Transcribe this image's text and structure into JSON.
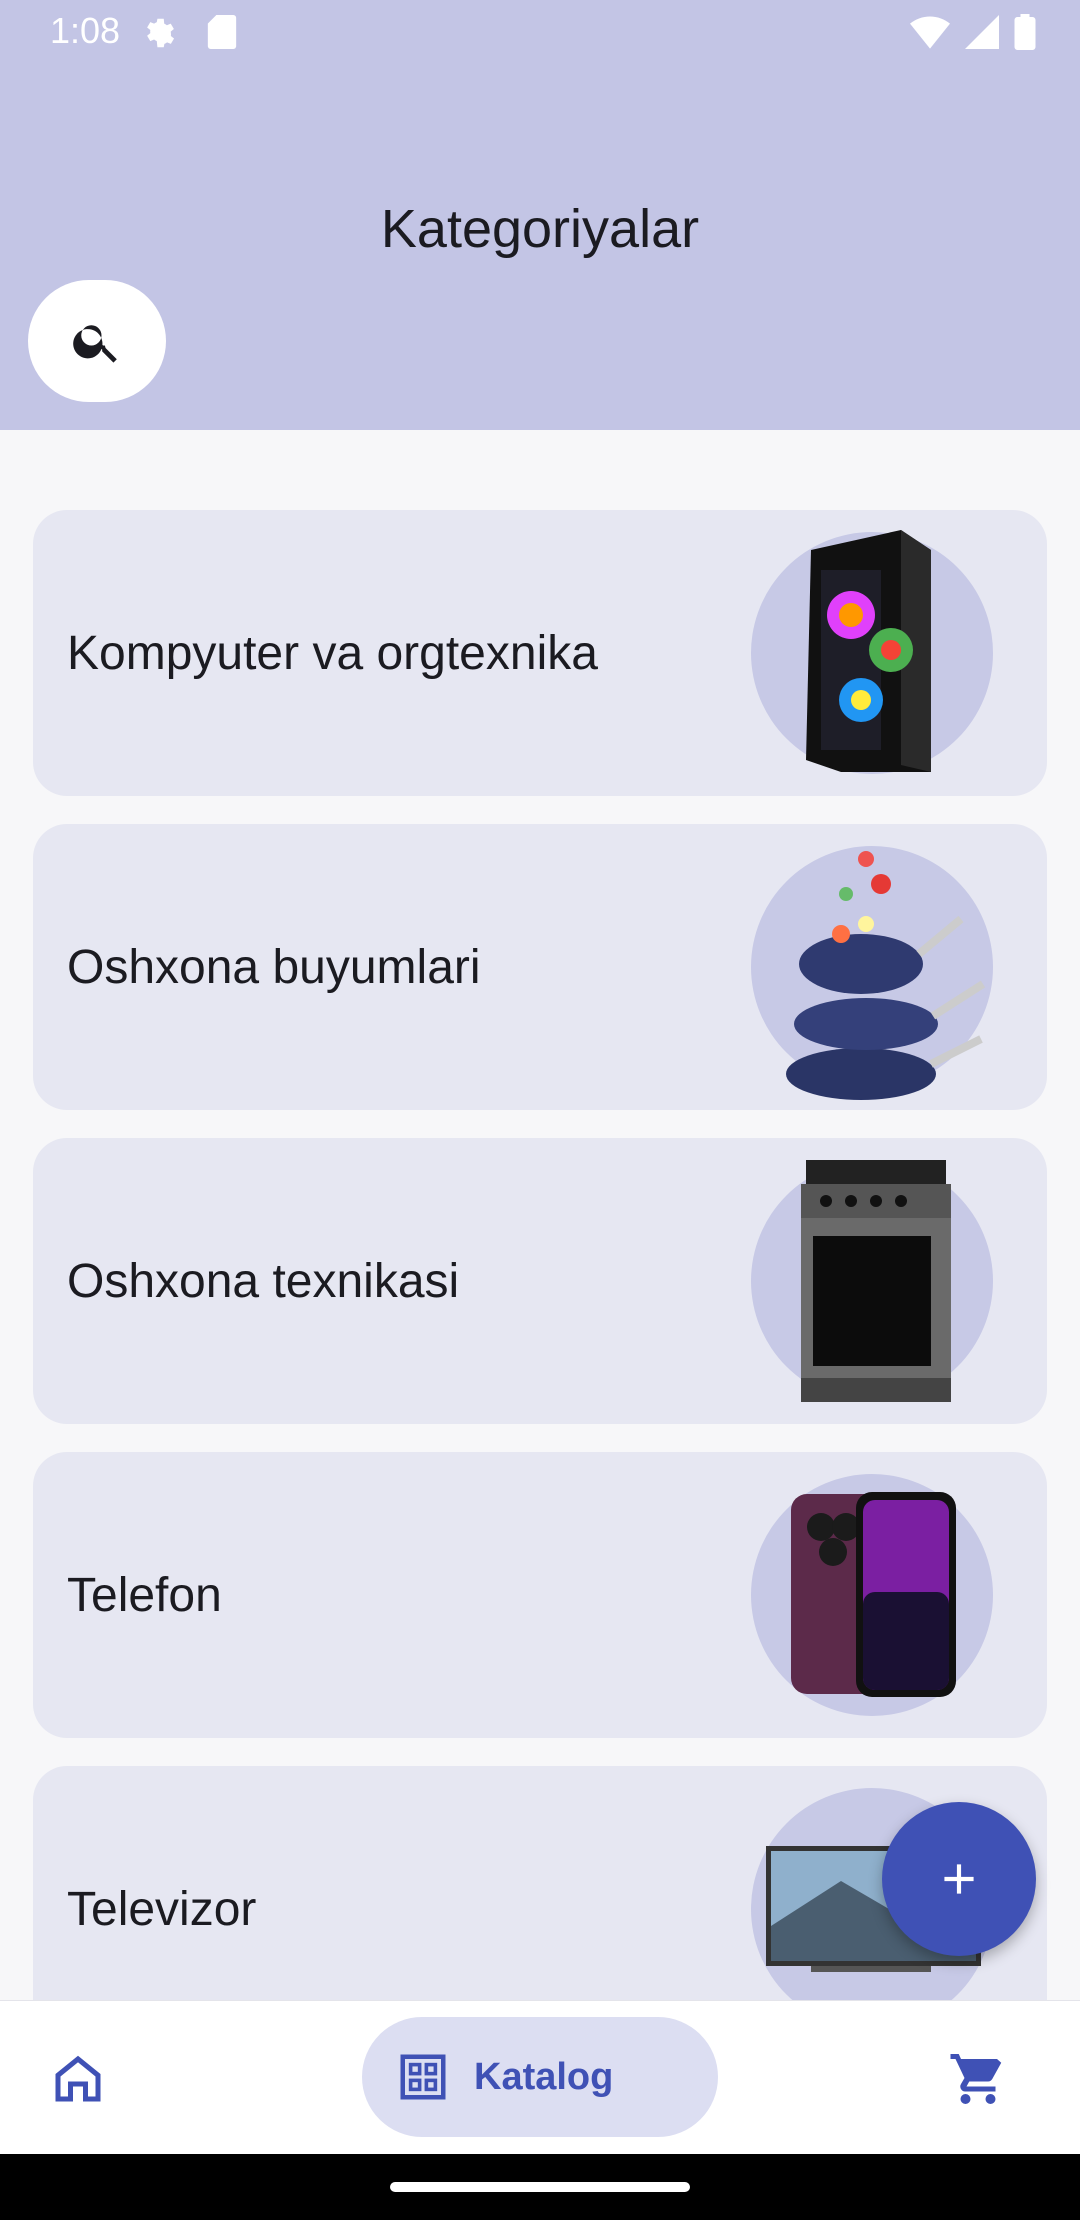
{
  "status_bar": {
    "time": "1:08",
    "icons": [
      "settings-gear-icon",
      "sd-card-icon",
      "wifi-icon",
      "signal-icon",
      "battery-icon"
    ]
  },
  "header": {
    "title": "Kategoriyalar",
    "search_icon": "search-icon"
  },
  "categories": [
    {
      "label": "Kompyuter va orgtexnika",
      "image": "computer-case-image"
    },
    {
      "label": "Oshxona buyumlari",
      "image": "pans-image"
    },
    {
      "label": "Oshxona texnikasi",
      "image": "stove-image"
    },
    {
      "label": "Telefon",
      "image": "phone-image"
    },
    {
      "label": "Televizor",
      "image": "tv-image"
    }
  ],
  "fab": {
    "icon": "plus-icon"
  },
  "bottom_nav": {
    "items": [
      {
        "icon": "home-icon",
        "label": ""
      },
      {
        "icon": "grid-icon",
        "label": "Katalog",
        "selected": true
      },
      {
        "icon": "cart-icon",
        "label": ""
      }
    ]
  },
  "colors": {
    "header_bg": "#c3c5e5",
    "card_bg": "#e6e7f2",
    "circle_bg": "#c7c9e6",
    "accent": "#3f51b5"
  }
}
